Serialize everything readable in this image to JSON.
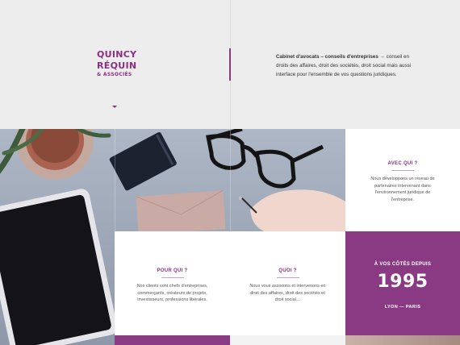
{
  "header": {
    "logo": {
      "line1": "QUINCY",
      "line2": "RÉQUIN",
      "line3": "& ASSOCIÉS"
    },
    "intro": {
      "bold": "Cabinet d'avocats – conseils d'entreprises",
      "rest": " → conseil en droits des affaires, droit des sociétés, droit social mais aussi interface pour l'ensemble de vos questions juridiques."
    }
  },
  "cards": {
    "avec_qui": {
      "title": "AVEC QUI ?",
      "text": "Nous développons un réseau de partenaires intervenant dans l'environnement juridique de l'entreprise."
    },
    "pour_qui": {
      "title": "POUR QUI ?",
      "text": "Nos clients sont chefs d'entreprises, commerçants, créateurs de projets, investisseurs, professions libérales."
    },
    "quoi": {
      "title": "QUOI ?",
      "text": "Nous vous assistons et intervenons en droit des affaires, droit des sociétés et droit social…"
    }
  },
  "since": {
    "label": "À VOS CÔTÉS DEPUIS",
    "year": "1995",
    "cities": "LYON — PARIS"
  },
  "colors": {
    "accent": "#8a2f82",
    "purple_block": "#8a3a83",
    "background": "#ededed"
  }
}
